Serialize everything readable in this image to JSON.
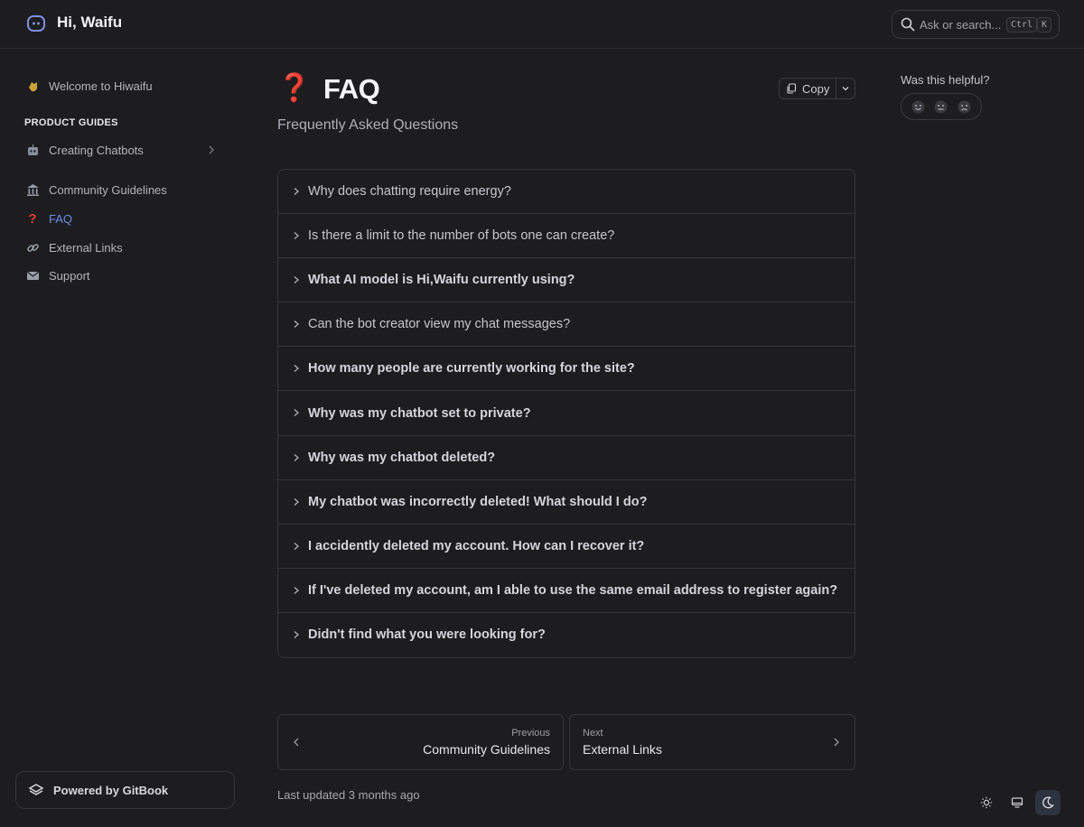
{
  "header": {
    "site_title": "Hi, Waifu",
    "search_placeholder": "Ask or search...",
    "shortcut_ctrl": "Ctrl",
    "shortcut_key": "K"
  },
  "sidebar": {
    "items_top": [
      {
        "label": "Welcome to Hiwaifu",
        "icon": "clapping-hands-icon"
      }
    ],
    "section_heading": "PRODUCT GUIDES",
    "items": [
      {
        "label": "Creating Chatbots",
        "icon": "robot-icon"
      },
      {
        "label": "Community Guidelines",
        "icon": "classical-building-icon"
      },
      {
        "label": "FAQ",
        "icon": "question-mark-icon",
        "active": true
      },
      {
        "label": "External Links",
        "icon": "link-icon"
      },
      {
        "label": "Support",
        "icon": "envelope-icon"
      }
    ],
    "powered_by": "Powered by GitBook"
  },
  "main": {
    "title": "FAQ",
    "subtitle": "Frequently Asked Questions",
    "copy_label": "Copy",
    "faq": [
      {
        "q": "Why does chatting require energy?"
      },
      {
        "q": "Is there a limit to the number of bots one can create?"
      },
      {
        "q": "What AI model is Hi,Waifu currently using?"
      },
      {
        "q": "Can the bot creator view my chat messages?"
      },
      {
        "q": "How many people are currently working for the site?"
      },
      {
        "q": "Why was my chatbot set to private?"
      },
      {
        "q": "Why was my chatbot deleted?"
      },
      {
        "q": "My chatbot was incorrectly deleted! What should I do?"
      },
      {
        "q": "I accidently deleted my account. How can I recover it?"
      },
      {
        "q": "If I've deleted my account, am I able to use the same email address to register again?"
      },
      {
        "q": "Didn't find what you were looking for?"
      }
    ],
    "prev": {
      "label": "Previous",
      "title": "Community Guidelines"
    },
    "next": {
      "label": "Next",
      "title": "External Links"
    },
    "last_updated": "Last updated 3 months ago"
  },
  "aside": {
    "helpful_label": "Was this helpful?"
  },
  "colors": {
    "background": "#1d1d1f",
    "accent": "#6a8fe8",
    "border": "#35353a"
  }
}
